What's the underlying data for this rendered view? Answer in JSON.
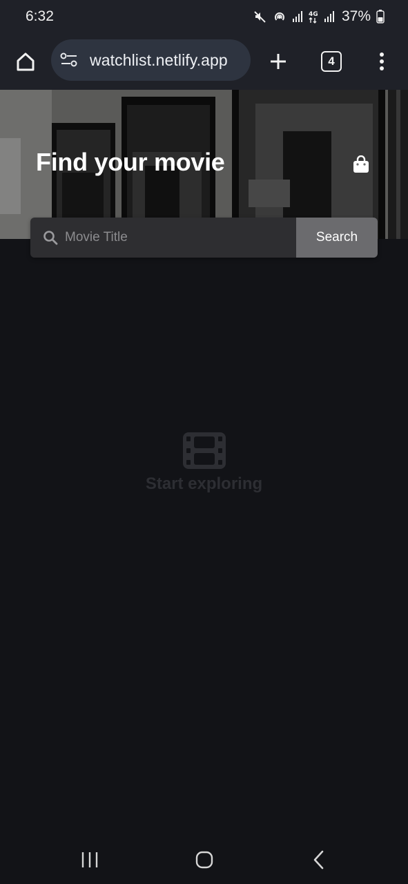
{
  "status_bar": {
    "time": "6:32",
    "network_label": "4G",
    "battery_percent": "37%",
    "icons": [
      "mute-icon",
      "hotspot-icon",
      "signal-icon",
      "4g-icon",
      "signal-icon",
      "battery-icon"
    ]
  },
  "browser": {
    "url": "watchlist.netlify.app",
    "tab_count": "4",
    "icons": [
      "home-icon",
      "site-settings-icon",
      "new-tab-icon",
      "tabs-icon",
      "menu-icon"
    ]
  },
  "hero": {
    "title": "Find your movie",
    "icon": "shopping-bag-icon"
  },
  "search": {
    "placeholder": "Movie Title",
    "value": "",
    "button_label": "Search"
  },
  "empty_state": {
    "icon": "film-icon",
    "text": "Start exploring"
  },
  "system_nav": {
    "icons": [
      "recent-apps-icon",
      "home-button-icon",
      "back-icon"
    ]
  },
  "colors": {
    "background": "#121317",
    "toolbar": "#1f2128",
    "omnibox": "#2e3440",
    "search_field": "#2e2e31",
    "search_button": "#6b6b6e",
    "empty_state_text": "#2d2e33"
  }
}
